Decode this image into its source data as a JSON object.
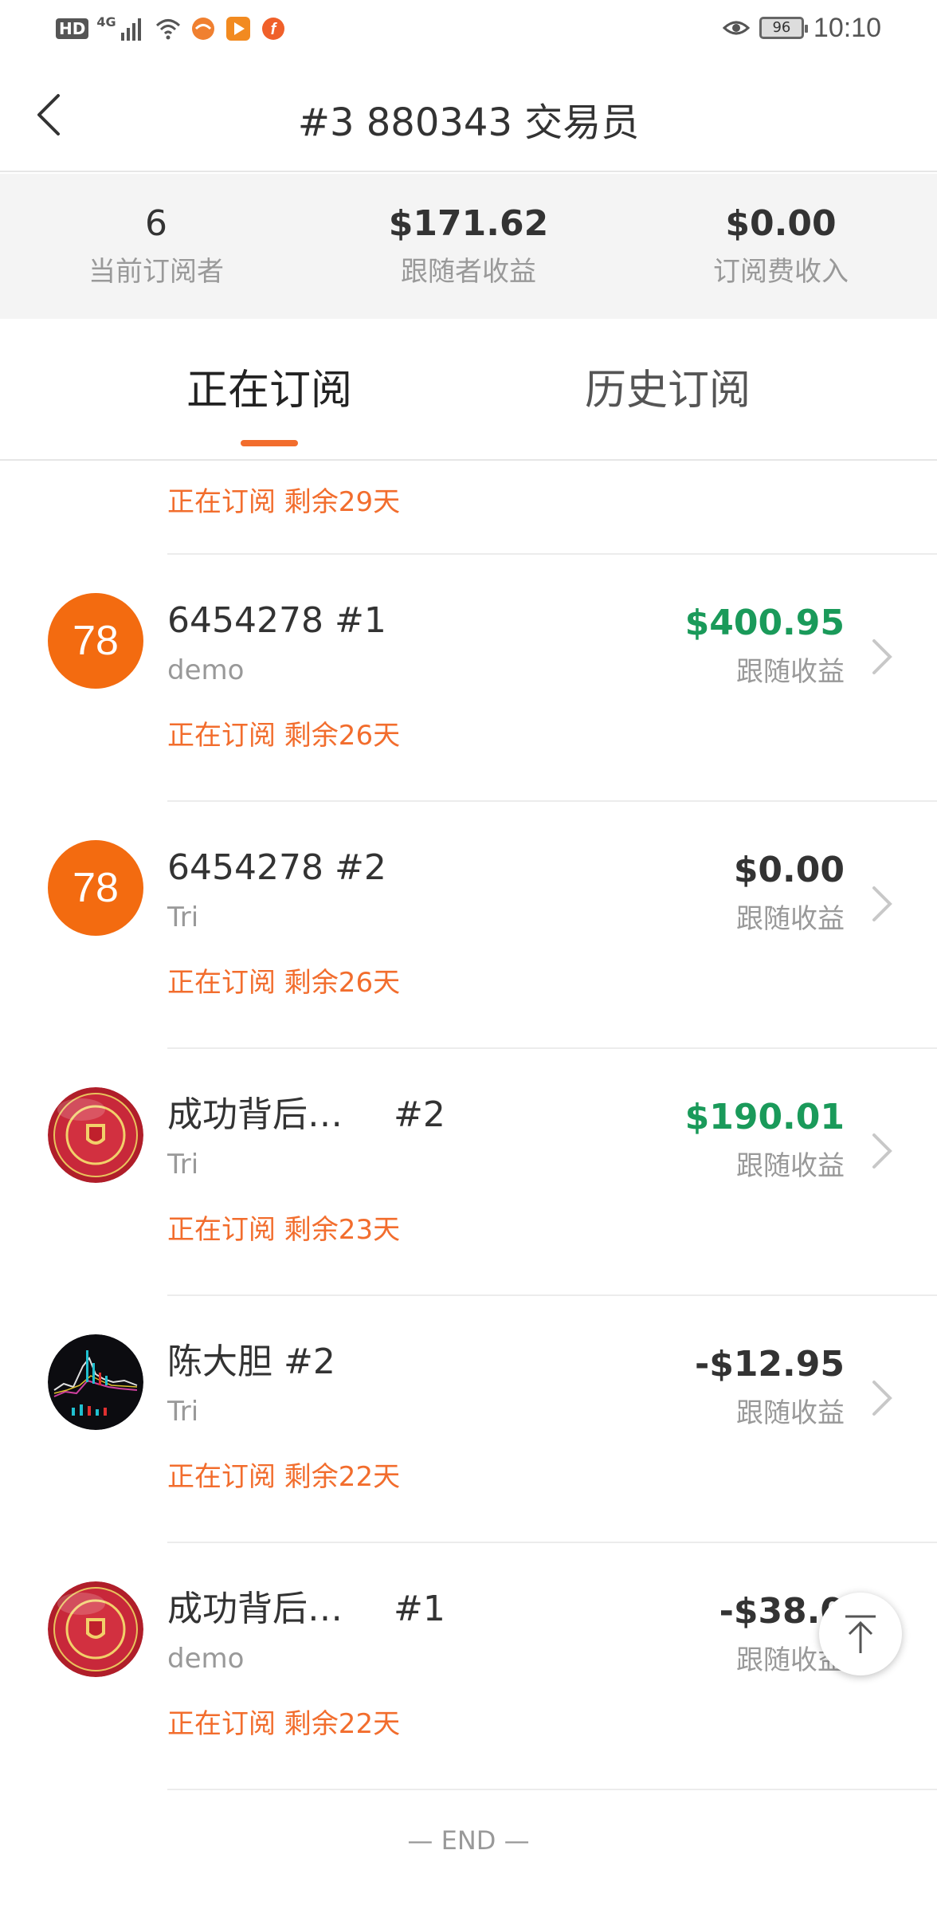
{
  "status_bar": {
    "hd_label": "HD",
    "network": "4G",
    "battery": "96",
    "time": "10:10",
    "icons": [
      "signal-icon",
      "wifi-icon",
      "app-notification-icon",
      "video-app-icon",
      "app-f-icon",
      "eye-icon",
      "battery-icon"
    ]
  },
  "nav": {
    "title": "#3 880343 交易员",
    "back_icon": "chevron-left-icon"
  },
  "stats": {
    "subscribers_value": "6",
    "subscribers_label": "当前订阅者",
    "follower_profit_value": "$171.62",
    "follower_profit_label": "跟随者收益",
    "fee_income_value": "$0.00",
    "fee_income_label": "订阅费收入"
  },
  "tabs": {
    "active": "正在订阅",
    "history": "历史订阅"
  },
  "list": {
    "first_partial_status": "正在订阅 剩余29天",
    "amount_label": "跟随收益",
    "items": [
      {
        "avatar_text": "78",
        "title": "6454278 #1",
        "tag": "",
        "account": "demo",
        "status": "正在订阅 剩余26天",
        "amount": "$400.95",
        "amount_color": "#1a9a5a"
      },
      {
        "avatar_text": "78",
        "title": "6454278 #2",
        "tag": "",
        "account": "Tri",
        "status": "正在订阅 剩余26天",
        "amount": "$0.00",
        "amount_color": "#333333"
      },
      {
        "avatar_text": "",
        "title": "成功背后…",
        "tag": "#2",
        "account": "Tri",
        "status": "正在订阅 剩余23天",
        "amount": "$190.01",
        "amount_color": "#1a9a5a"
      },
      {
        "avatar_text": "",
        "title": "陈大胆 #2",
        "tag": "",
        "account": "Tri",
        "status": "正在订阅 剩余22天",
        "amount": "-$12.95",
        "amount_color": "#333333"
      },
      {
        "avatar_text": "",
        "title": "成功背后…",
        "tag": "#1",
        "account": "demo",
        "status": "正在订阅 剩余22天",
        "amount": "-$38.0",
        "amount_color": "#333333"
      }
    ]
  },
  "end_text": "— END —",
  "colors": {
    "accent": "#f26d2d",
    "profit_green": "#1a9a5a",
    "avatar_orange": "#f36b10"
  }
}
